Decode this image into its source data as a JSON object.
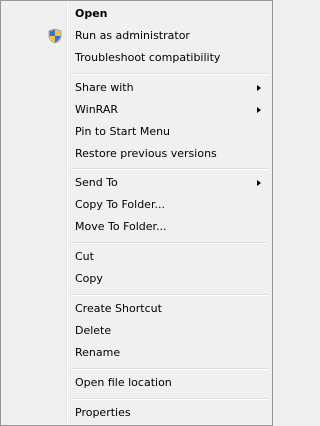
{
  "menu": {
    "items": [
      {
        "label": "Open"
      },
      {
        "label": "Run as administrator",
        "icon": "uac-shield-icon"
      },
      {
        "label": "Troubleshoot compatibility"
      },
      {
        "label": "Share with"
      },
      {
        "label": "WinRAR"
      },
      {
        "label": "Pin to Start Menu"
      },
      {
        "label": "Restore previous versions"
      },
      {
        "label": "Send To"
      },
      {
        "label": "Copy To Folder..."
      },
      {
        "label": "Move To Folder..."
      },
      {
        "label": "Cut"
      },
      {
        "label": "Copy"
      },
      {
        "label": "Create Shortcut"
      },
      {
        "label": "Delete"
      },
      {
        "label": "Rename"
      },
      {
        "label": "Open file location"
      },
      {
        "label": "Properties"
      }
    ]
  }
}
